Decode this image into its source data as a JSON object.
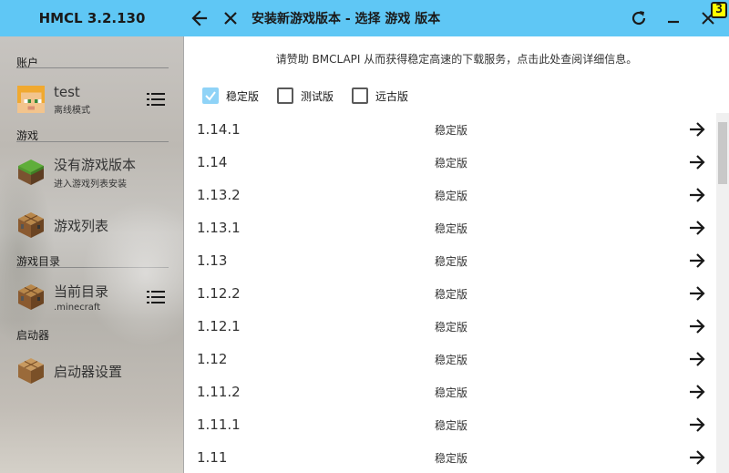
{
  "app": {
    "title": "HMCL 3.2.130"
  },
  "header": {
    "page_title": "安装新游戏版本 - 选择 游戏 版本",
    "badge": "3"
  },
  "sidebar": {
    "account_section": "账户",
    "account": {
      "name": "test",
      "mode": "离线模式"
    },
    "game_section": "游戏",
    "no_version": {
      "label": "没有游戏版本",
      "sub": "进入游戏列表安装"
    },
    "game_list": {
      "label": "游戏列表"
    },
    "dir_section": "游戏目录",
    "current_dir": {
      "label": "当前目录",
      "sub": ".minecraft"
    },
    "launcher_section": "启动器",
    "launcher_settings": {
      "label": "启动器设置"
    }
  },
  "main": {
    "notice": "请赞助 BMCLAPI 从而获得稳定高速的下载服务，点击此处查阅详细信息。",
    "filters": [
      {
        "label": "稳定版",
        "checked": true
      },
      {
        "label": "测试版",
        "checked": false
      },
      {
        "label": "远古版",
        "checked": false
      }
    ],
    "versions": [
      {
        "id": "1.14.1",
        "type": "稳定版"
      },
      {
        "id": "1.14",
        "type": "稳定版"
      },
      {
        "id": "1.13.2",
        "type": "稳定版"
      },
      {
        "id": "1.13.1",
        "type": "稳定版"
      },
      {
        "id": "1.13",
        "type": "稳定版"
      },
      {
        "id": "1.12.2",
        "type": "稳定版"
      },
      {
        "id": "1.12.1",
        "type": "稳定版"
      },
      {
        "id": "1.12",
        "type": "稳定版"
      },
      {
        "id": "1.11.2",
        "type": "稳定版"
      },
      {
        "id": "1.11.1",
        "type": "稳定版"
      },
      {
        "id": "1.11",
        "type": "稳定版"
      }
    ]
  },
  "colors": {
    "accent": "#5fc7f5",
    "checkbox_checked": "#8fd3f7"
  },
  "icons": [
    "back-arrow-icon",
    "close-icon",
    "refresh-icon",
    "minimize-icon",
    "window-close-icon",
    "menu-icon",
    "grass-block-icon",
    "crafting-table-icon",
    "arrow-right-icon"
  ]
}
